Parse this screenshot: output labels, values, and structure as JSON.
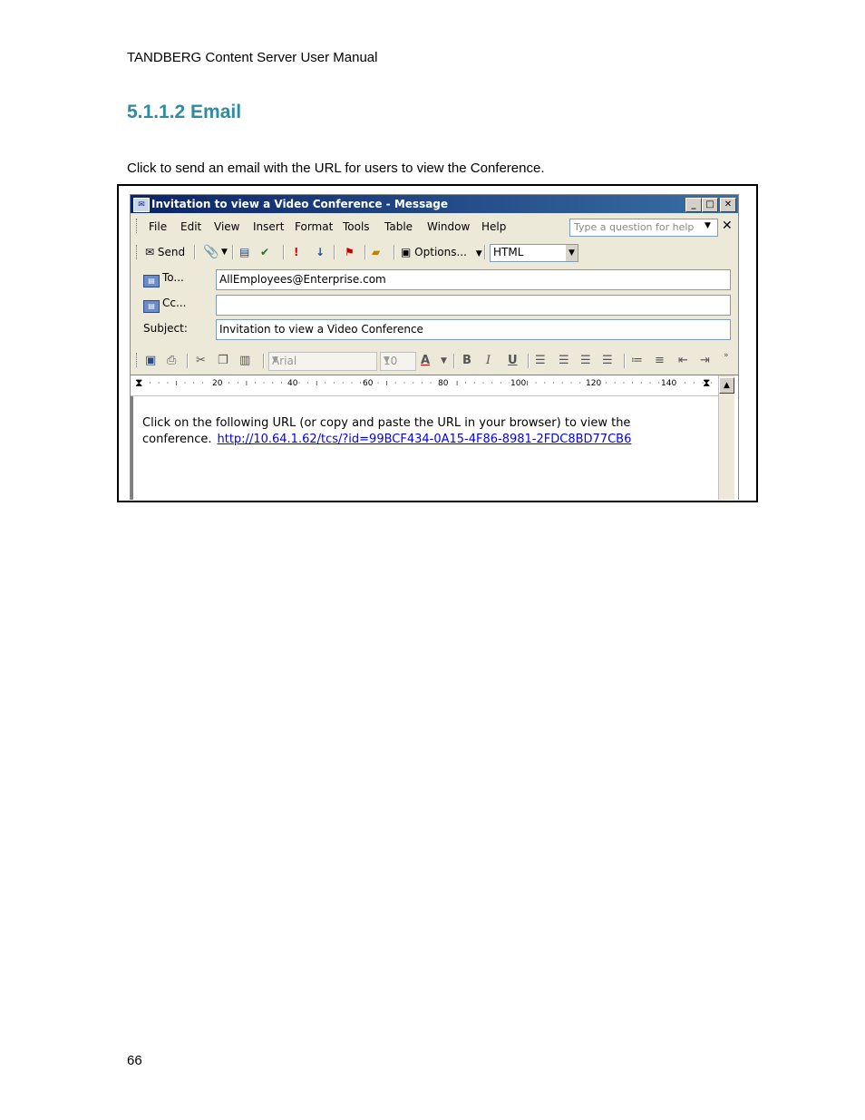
{
  "page": {
    "header": "TANDBERG Content Server User Manual",
    "section_title": "5.1.1.2 Email",
    "paragraph": "Click to send an email with the URL for users to view the Conference.",
    "page_number": "66"
  },
  "window": {
    "title": "Invitation to view a Video Conference - Message",
    "buttons": {
      "minimize": "_",
      "maximize": "□",
      "close": "✕"
    },
    "menu": [
      "File",
      "Edit",
      "View",
      "Insert",
      "Format",
      "Tools",
      "Table",
      "Window",
      "Help"
    ],
    "help_placeholder": "Type a question for help",
    "menu_close": "✕",
    "toolbar": {
      "send": "Send",
      "options": "Options...",
      "format": "HTML"
    },
    "fields": {
      "to_label": "To...",
      "to_value": "AllEmployees@Enterprise.com",
      "cc_label": "Cc...",
      "cc_value": "",
      "subject_label": "Subject:",
      "subject_value": "Invitation to view a Video Conference"
    },
    "formatting": {
      "font": "Arial",
      "size": "10"
    },
    "ruler": [
      "20",
      "40",
      "60",
      "80",
      "100",
      "120",
      "140"
    ],
    "body": {
      "line1": "Click on the following URL (or copy and paste the URL in your browser) to view the",
      "line2": "conference.",
      "link": "http://10.64.1.62/tcs/?id=99BCF434-0A15-4F86-8981-2FDC8BD77CB6"
    }
  },
  "icons": [
    "envelope-icon",
    "paperclip-icon",
    "address-book-icon",
    "check-names-icon",
    "importance-high-icon",
    "importance-low-icon",
    "flag-icon",
    "folder-icon",
    "options-icon",
    "save-icon",
    "print-icon",
    "cut-icon",
    "copy-icon",
    "paste-icon",
    "bold-icon",
    "italic-icon",
    "underline-icon",
    "align-left-icon",
    "align-center-icon",
    "align-right-icon",
    "justify-icon",
    "numbered-list-icon",
    "bullet-list-icon",
    "outdent-icon",
    "indent-icon"
  ],
  "colors": {
    "section_title": "#2e8ba0",
    "title_bar": "#0a246a",
    "link": "#0000ee"
  }
}
